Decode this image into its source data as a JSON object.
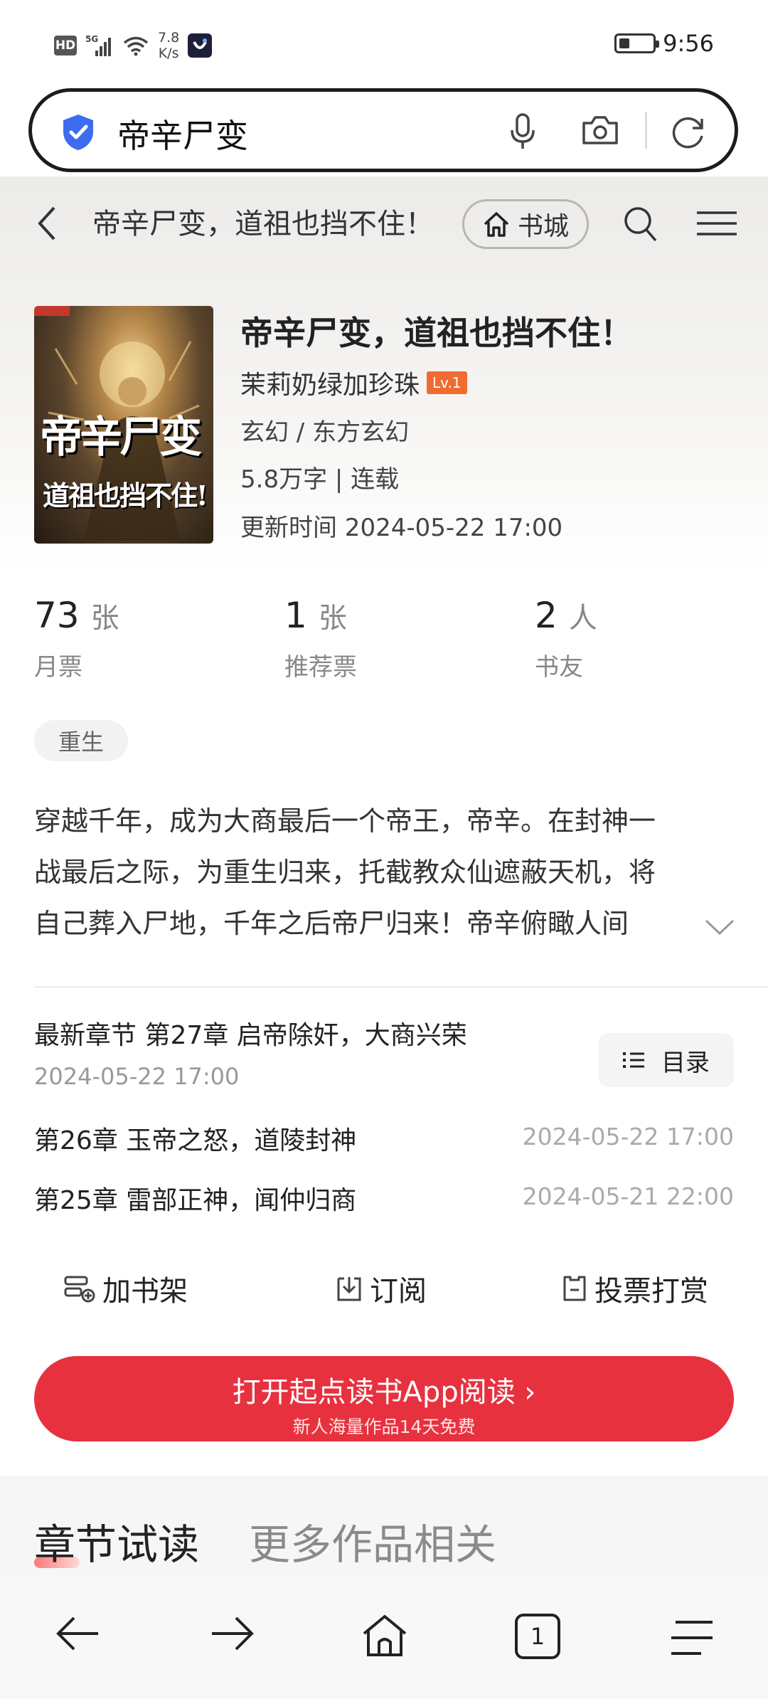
{
  "status_bar": {
    "hd": "HD",
    "network": "5G",
    "speed_value": "7.8",
    "speed_unit": "K/s",
    "time": "9:56"
  },
  "search": {
    "query": "帝辛尸变"
  },
  "nav": {
    "title": "帝辛尸变，道祖也挡不住！",
    "store_label": "书城"
  },
  "book": {
    "cover_title_line1": "帝辛尸变",
    "cover_title_line2": "道祖也挡不住!",
    "title": "帝辛尸变，道祖也挡不住！",
    "author": "茉莉奶绿加珍珠",
    "author_level": "Lv.1",
    "genre": "玄幻 / 东方玄幻",
    "words_status": "5.8万字 | 连载",
    "update_time": "更新时间 2024-05-22 17:00"
  },
  "stats": [
    {
      "value": "73",
      "unit": "张",
      "label": "月票"
    },
    {
      "value": "1",
      "unit": "张",
      "label": "推荐票"
    },
    {
      "value": "2",
      "unit": "人",
      "label": "书友"
    }
  ],
  "tag": "重生",
  "description": [
    "穿越千年，成为大商最后一个帝王，帝辛。在封神一",
    "战最后之际，为重生归来，托截教众仙遮蔽天机，将",
    "自己葬入尸地，千年之后帝尸归来！帝辛俯瞰人间"
  ],
  "chapters": {
    "latest_label": "最新章节 第27章 启帝除奸，大商兴荣",
    "latest_time": "2024-05-22 17:00",
    "toc_label": "目录",
    "items": [
      {
        "title": "第26章 玉帝之怒，道陵封神",
        "time": "2024-05-22 17:00"
      },
      {
        "title": "第25章 雷部正神，闻仲归商",
        "time": "2024-05-21 22:00"
      }
    ]
  },
  "actions": {
    "shelf": "加书架",
    "subscribe": "订阅",
    "vote": "投票打赏"
  },
  "cta": {
    "main": "打开起点读书App阅读 ›",
    "sub": "新人海量作品14天免费"
  },
  "tabs": {
    "active": "章节试读",
    "other": "更多作品相关"
  },
  "bottom_nav": {
    "tab_count": "1"
  },
  "colors": {
    "accent_red": "#e8313f",
    "level_orange": "#f06b2f",
    "shield_blue": "#3d6cf0"
  }
}
